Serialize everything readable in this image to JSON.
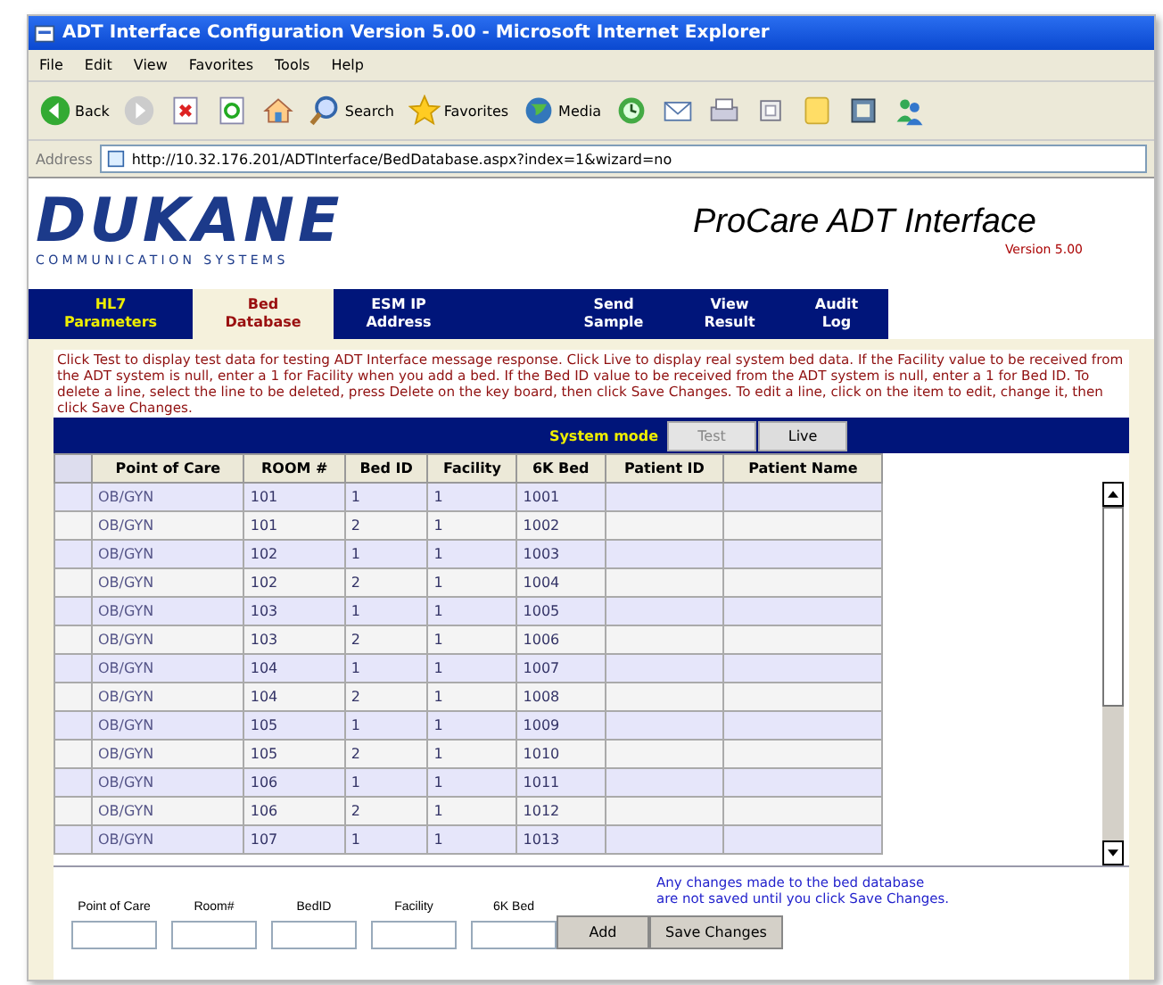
{
  "window": {
    "title": "ADT Interface Configuration Version 5.00 - Microsoft Internet Explorer"
  },
  "menu": [
    "File",
    "Edit",
    "View",
    "Favorites",
    "Tools",
    "Help"
  ],
  "toolbar": [
    {
      "kind": "back",
      "label": "Back"
    },
    {
      "kind": "forward"
    },
    {
      "kind": "stop"
    },
    {
      "kind": "refresh"
    },
    {
      "kind": "home"
    },
    {
      "kind": "search",
      "label": "Search"
    },
    {
      "kind": "favorites",
      "label": "Favorites"
    },
    {
      "kind": "media",
      "label": "Media"
    },
    {
      "kind": "history"
    },
    {
      "kind": "mail"
    },
    {
      "kind": "print"
    },
    {
      "kind": "edit"
    },
    {
      "kind": "folder"
    },
    {
      "kind": "research"
    },
    {
      "kind": "messenger"
    }
  ],
  "address": {
    "label": "Address",
    "url": "http://10.32.176.201/ADTInterface/BedDatabase.aspx?index=1&wizard=no"
  },
  "header": {
    "logo": "DUKANE",
    "logo_sub": "COMMUNICATION SYSTEMS",
    "title": "ProCare ADT Interface",
    "version": "Version 5.00"
  },
  "tabs": [
    {
      "label": [
        "HL7",
        "Parameters"
      ],
      "selected": false
    },
    {
      "label": [
        "Bed",
        "Database"
      ],
      "selected": true
    },
    {
      "label": [
        "ESM IP",
        "Address"
      ],
      "selected": false
    },
    {
      "kind": "blank",
      "selected": false
    },
    {
      "label": [
        "Send",
        "Sample"
      ],
      "selected": false
    },
    {
      "label": [
        "View",
        "Result"
      ],
      "selected": false
    },
    {
      "label": [
        "Audit",
        "Log"
      ],
      "selected": false
    }
  ],
  "instructions": "Click Test to display test data for testing ADT Interface message response. Click Live to display real system bed data. If the Facility value to be received from the ADT system is null, enter a 1 for Facility when you add a bed. If the Bed ID value to be received from the ADT system is null, enter a 1 for Bed ID.  To delete a line, select the line to be deleted, press Delete on the key board, then click Save Changes.  To edit a line, click on the item to edit, change it, then click Save Changes.",
  "system_mode": {
    "label": "System mode",
    "buttons": [
      {
        "label": "Test",
        "disabled": true
      },
      {
        "label": "Live",
        "disabled": false
      }
    ]
  },
  "table": {
    "columns": [
      "Point of Care",
      "ROOM #",
      "Bed ID",
      "Facility",
      "6K Bed",
      "Patient ID",
      "Patient Name"
    ],
    "rows": [
      [
        "OB/GYN",
        "101",
        "1",
        "1",
        "1001"
      ],
      [
        "OB/GYN",
        "101",
        "2",
        "1",
        "1002"
      ],
      [
        "OB/GYN",
        "102",
        "1",
        "1",
        "1003"
      ],
      [
        "OB/GYN",
        "102",
        "2",
        "1",
        "1004"
      ],
      [
        "OB/GYN",
        "103",
        "1",
        "1",
        "1005"
      ],
      [
        "OB/GYN",
        "103",
        "2",
        "1",
        "1006"
      ],
      [
        "OB/GYN",
        "104",
        "1",
        "1",
        "1007"
      ],
      [
        "OB/GYN",
        "104",
        "2",
        "1",
        "1008"
      ],
      [
        "OB/GYN",
        "105",
        "1",
        "1",
        "1009"
      ],
      [
        "OB/GYN",
        "105",
        "2",
        "1",
        "1010"
      ],
      [
        "OB/GYN",
        "106",
        "1",
        "1",
        "1011"
      ],
      [
        "OB/GYN",
        "106",
        "2",
        "1",
        "1012"
      ],
      [
        "OB/GYN",
        "107",
        "1",
        "1",
        "1013"
      ]
    ]
  },
  "form": {
    "fields": [
      "Point of Care",
      "Room#",
      "BedID",
      "Facility",
      "6K Bed"
    ],
    "buttons": [
      "Add",
      "Save Changes"
    ],
    "note": [
      "Any changes made to the bed database",
      "are not saved until you click Save Changes."
    ]
  }
}
